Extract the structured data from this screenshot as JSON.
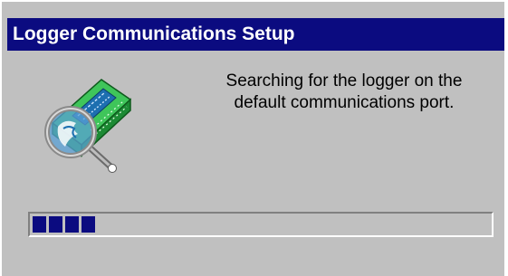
{
  "dialog": {
    "title": "Logger Communications Setup",
    "message_line1": "Searching for the logger on the",
    "message_line2": "default communications port.",
    "icon": "logger-magnifier-icon",
    "progress": {
      "segments_filled": 4,
      "fraction": 0.15
    }
  },
  "colors": {
    "titlebar": "#0b0b80",
    "face": "#c0c0c0",
    "progress_fill": "#0b0b80",
    "device_green": "#2fb84a"
  }
}
